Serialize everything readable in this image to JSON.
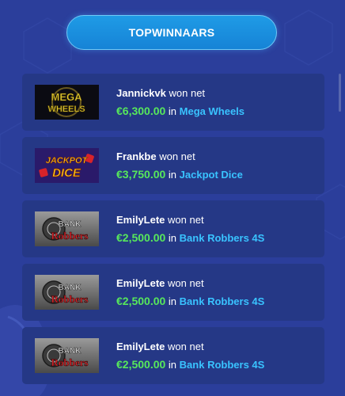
{
  "header": {
    "title": "TOPWINNAARS"
  },
  "winners": [
    {
      "user": "Jannickvk",
      "won_text": "won net",
      "amount": "€6,300.00",
      "in_text": "in",
      "game": "Mega Wheels",
      "thumb_icon": "mega-wheels-logo",
      "thumb_text_1": "MEGA",
      "thumb_text_2": "WHEELS"
    },
    {
      "user": "Frankbe",
      "won_text": "won net",
      "amount": "€3,750.00",
      "in_text": "in",
      "game": "Jackpot Dice",
      "thumb_icon": "jackpot-dice-logo",
      "thumb_text_1": "JACKPOT",
      "thumb_text_2": "DICE"
    },
    {
      "user": "EmilyLete",
      "won_text": "won net",
      "amount": "€2,500.00",
      "in_text": "in",
      "game": "Bank Robbers 4S",
      "thumb_icon": "bank-robbers-logo",
      "thumb_text_1": "BANK",
      "thumb_text_2": "Robbers"
    },
    {
      "user": "EmilyLete",
      "won_text": "won net",
      "amount": "€2,500.00",
      "in_text": "in",
      "game": "Bank Robbers 4S",
      "thumb_icon": "bank-robbers-logo",
      "thumb_text_1": "BANK",
      "thumb_text_2": "Robbers"
    },
    {
      "user": "EmilyLete",
      "won_text": "won net",
      "amount": "€2,500.00",
      "in_text": "in",
      "game": "Bank Robbers 4S",
      "thumb_icon": "bank-robbers-logo",
      "thumb_text_1": "BANK",
      "thumb_text_2": "Robbers"
    }
  ],
  "colors": {
    "background": "#2b3e9b",
    "card": "#253886",
    "amount": "#57e85b",
    "link": "#39c3ff",
    "button": "#1683d6"
  }
}
